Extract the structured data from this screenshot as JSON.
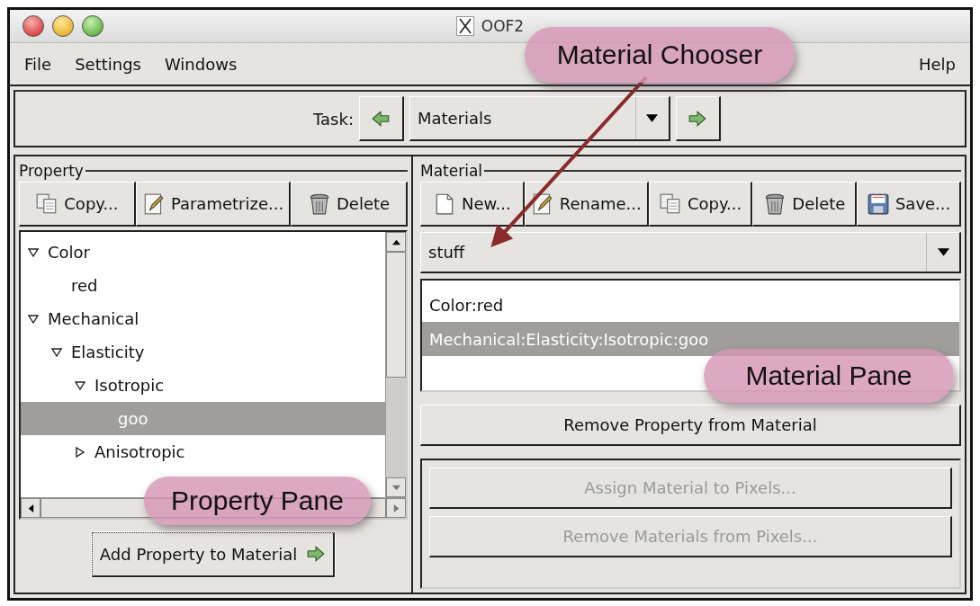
{
  "window": {
    "title": "OOF2"
  },
  "menu": {
    "left": [
      "File",
      "Settings",
      "Windows"
    ],
    "right": [
      "Help"
    ]
  },
  "task": {
    "label": "Task:",
    "value": "Materials"
  },
  "property_pane": {
    "title": "Property",
    "buttons": [
      {
        "label": "Copy...",
        "kind": "copy"
      },
      {
        "label": "Parametrize...",
        "kind": "edit"
      },
      {
        "label": "Delete",
        "kind": "trash"
      }
    ],
    "tree": [
      {
        "label": "Color",
        "expanded": true,
        "selected": false,
        "children": [
          {
            "label": "red",
            "selected": false
          }
        ]
      },
      {
        "label": "Mechanical",
        "expanded": true,
        "selected": false,
        "children": [
          {
            "label": "Elasticity",
            "expanded": true,
            "selected": false,
            "children": [
              {
                "label": "Isotropic",
                "expanded": true,
                "selected": false,
                "children": [
                  {
                    "label": "goo",
                    "selected": true
                  }
                ]
              },
              {
                "label": "Anisotropic",
                "expanded": false,
                "selected": false
              }
            ]
          }
        ]
      }
    ],
    "add_button": "Add Property to Material"
  },
  "material_pane": {
    "title": "Material",
    "buttons": [
      {
        "label": "New...",
        "kind": "page"
      },
      {
        "label": "Rename...",
        "kind": "edit"
      },
      {
        "label": "Copy...",
        "kind": "copy"
      },
      {
        "label": "Delete",
        "kind": "trash"
      },
      {
        "label": "Save...",
        "kind": "floppy"
      }
    ],
    "chooser": "stuff",
    "properties": [
      {
        "label": "Color:red",
        "selected": false
      },
      {
        "label": "Mechanical:Elasticity:Isotropic:goo",
        "selected": true
      }
    ],
    "remove_button": {
      "label": "Remove Property from Material",
      "disabled": false
    },
    "pixel_buttons": [
      {
        "label": "Assign Material to Pixels...",
        "disabled": true
      },
      {
        "label": "Remove Materials from Pixels...",
        "disabled": true
      }
    ]
  },
  "callouts": [
    {
      "text": "Material Chooser"
    },
    {
      "text": "Material Pane"
    },
    {
      "text": "Property Pane"
    }
  ]
}
